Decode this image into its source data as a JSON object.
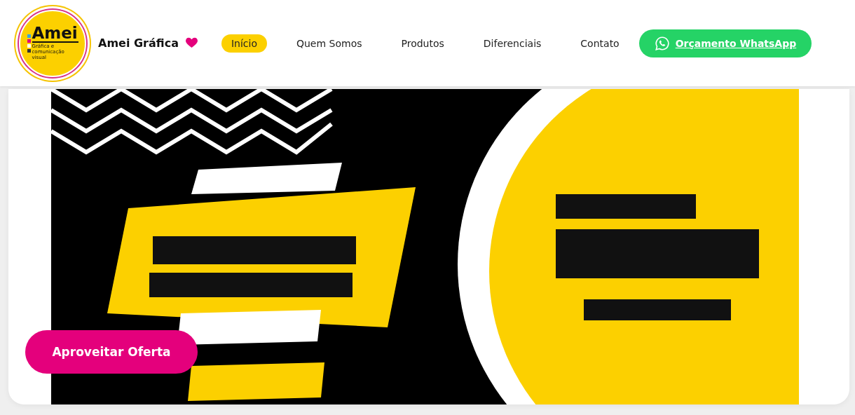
{
  "logo": {
    "wordmark": "Amei",
    "tagline": "Gráfica e comunicação visual"
  },
  "brand": {
    "name": "Amei Gráfica"
  },
  "nav": [
    {
      "label": "Início",
      "selected": true
    },
    {
      "label": "Quem Somos",
      "selected": false
    },
    {
      "label": "Produtos",
      "selected": false
    },
    {
      "label": "Diferenciais",
      "selected": false
    },
    {
      "label": "Contato",
      "selected": false
    }
  ],
  "cta": {
    "label": "Orçamento WhatsApp"
  },
  "hero": {
    "button": "Aproveitar Oferta"
  }
}
